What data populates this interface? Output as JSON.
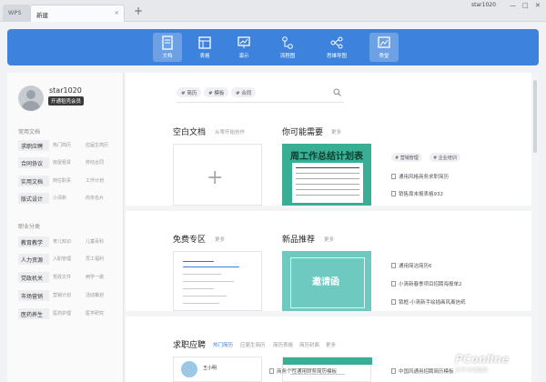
{
  "titlebar": {
    "brand": "WPS",
    "active_tab": "新建",
    "new_tab": "+",
    "user": "star1020",
    "close_tab": "×",
    "min": "—",
    "max": "□",
    "close": "✕"
  },
  "toolbar": {
    "items": [
      {
        "label": "文档",
        "icon": "document-icon"
      },
      {
        "label": "表格",
        "icon": "table-icon"
      },
      {
        "label": "演示",
        "icon": "presentation-icon"
      },
      {
        "label": "流程图",
        "icon": "flowchart-icon"
      },
      {
        "label": "思维导图",
        "icon": "mindmap-icon"
      },
      {
        "label": "秀堂",
        "icon": "showcase-icon"
      }
    ]
  },
  "sidebar": {
    "username": "star1020",
    "vip_label": "开通稻壳会员",
    "common_title": "常用文档",
    "common": [
      {
        "name": "求职应聘",
        "s1": "热门简历",
        "s2": "应届生简历"
      },
      {
        "name": "合同协议",
        "s1": "房屋租赁",
        "s2": "劳动合同"
      },
      {
        "name": "实用文档",
        "s1": "岗位职责",
        "s2": "工作计划"
      },
      {
        "name": "版式设计",
        "s1": "小清新",
        "s2": "商务名片"
      }
    ],
    "career_title": "职业分类",
    "career": [
      {
        "name": "教育教学",
        "s1": "育儿知识",
        "s2": "儿童百科"
      },
      {
        "name": "人力资源",
        "s1": "入职管理",
        "s2": "员工福利"
      },
      {
        "name": "党政机关",
        "s1": "党政文件",
        "s2": "两学一做"
      },
      {
        "name": "市场营销",
        "s1": "营销计划",
        "s2": "活动策划"
      },
      {
        "name": "医药养生",
        "s1": "医药护理",
        "s2": "医学研究"
      }
    ]
  },
  "search": {
    "chips": [
      "# 简历",
      "# 模板",
      "# 合同"
    ]
  },
  "sections": {
    "blank": {
      "title": "空白文档",
      "link": "从零开始创作"
    },
    "recommend": {
      "title": "你可能需要",
      "more": "更多",
      "thumb_title": "周工作总结计划表",
      "tags": [
        "# 营销管理",
        "# 企业培训"
      ],
      "items": [
        "通用风格商务求职简历",
        "销售周末报表格932"
      ]
    },
    "free": {
      "title": "免费专区",
      "more": "更多"
    },
    "newest": {
      "title": "新品推荐",
      "more": "更多",
      "thumb_title": "邀请函",
      "items": [
        "通用简洁简历6",
        "小清新春季项目招聘海报单2",
        "锁框-小清新手绘插画风离信纸"
      ]
    },
    "jobs": {
      "title": "求职应聘",
      "links": [
        "热门简历",
        "应届生简历",
        "简历表格",
        "简历封面",
        "更多"
      ],
      "card_name": "王小明",
      "items": [
        "商务个性通用财务简历模板",
        "中国风通用招聘简历模板"
      ]
    }
  },
  "watermark": {
    "brand": "PConline",
    "sub": "太平洋电脑网"
  }
}
